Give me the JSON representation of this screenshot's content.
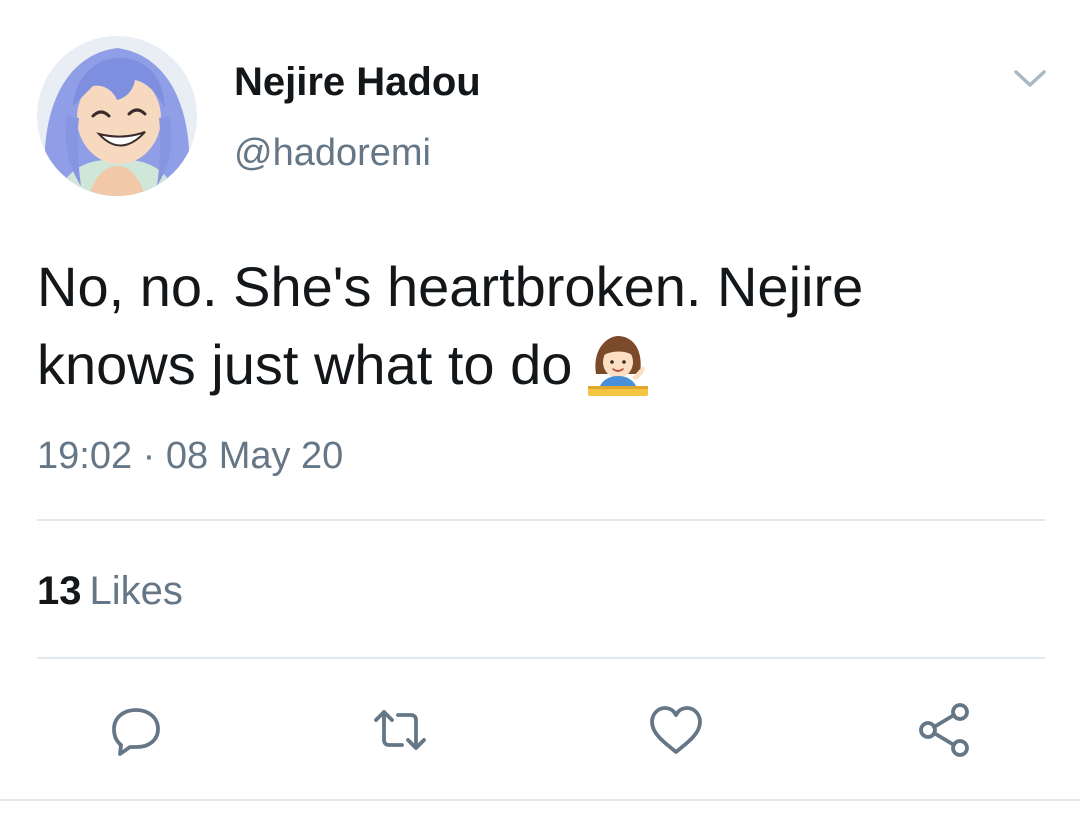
{
  "user": {
    "display_name": "Nejire Hadou",
    "handle": "@hadoremi"
  },
  "tweet": {
    "line1": "No, no. She's heartbroken. Nejire",
    "line2": "knows just what to do",
    "emoji": "woman-tipping-hand-icon",
    "timestamp": "19:02 · 08 May 20"
  },
  "stats": {
    "likes_count": "13",
    "likes_label": "Likes"
  },
  "icons": {
    "menu": "chevron-down-icon",
    "reply": "reply-icon",
    "retweet": "retweet-icon",
    "like": "heart-icon",
    "share": "share-icon"
  },
  "colors": {
    "text": "#14171a",
    "secondary": "#657786",
    "divider": "#e1e8ed"
  }
}
